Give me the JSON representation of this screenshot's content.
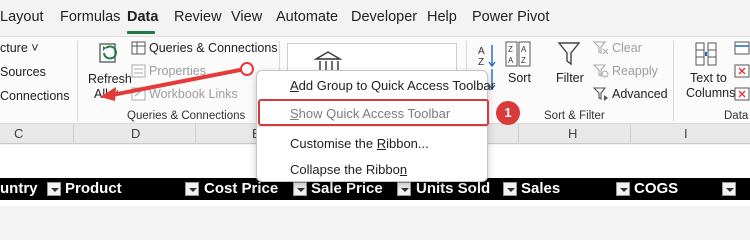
{
  "tabs": [
    "Layout",
    "Formulas",
    "Data",
    "Review",
    "View",
    "Automate",
    "Developer",
    "Help",
    "Power Pivot"
  ],
  "active_tab": "Data",
  "ribbon": {
    "left_items": [
      "cture ˅",
      "Sources",
      "Connections"
    ],
    "refresh_label_1": "Refresh",
    "refresh_label_2": "All ˅",
    "queries_connections": "Queries & Connections",
    "properties": "Properties",
    "workbook_links": "Workbook Links",
    "group_queries": "Queries & Connections",
    "sort": "Sort",
    "filter": "Filter",
    "clear": "Clear",
    "reapply": "Reapply",
    "advanced": "Advanced",
    "group_sort_filter": "Sort & Filter",
    "text_to_1": "Text to",
    "text_to_2": "Columns",
    "group_data_tools": "Data T"
  },
  "column_letters": [
    "C",
    "D",
    "E",
    "H",
    "I"
  ],
  "table_headers": [
    "untry",
    "Product",
    "Cost Price",
    "Sale Price",
    "Units Sold",
    "Sales",
    "COGS"
  ],
  "context_menu": {
    "items": [
      {
        "pre": "",
        "key": "A",
        "post": "dd Group to Quick Access Toolbar"
      },
      {
        "pre": "",
        "key": "S",
        "post": "how Quick Access Toolbar"
      },
      {
        "pre": "Customise the ",
        "key": "R",
        "post": "ibbon..."
      },
      {
        "pre": "Collapse the Ribbo",
        "key": "n",
        "post": ""
      }
    ]
  },
  "callout_badge": "1",
  "colors": {
    "accent_green": "#1e7b45",
    "callout_red": "#d93b3b",
    "table_header_bg": "#000000"
  }
}
